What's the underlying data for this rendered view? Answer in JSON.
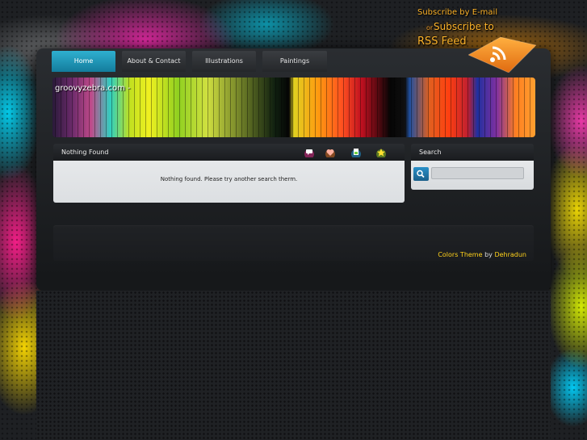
{
  "subscribe": {
    "email": "Subscribe by E-mail",
    "or": "or",
    "to": "Subscribe to",
    "rss": "RSS Feed"
  },
  "nav": {
    "tabs": [
      {
        "label": "Home",
        "active": true
      },
      {
        "label": "About & Contact",
        "active": false
      },
      {
        "label": "Illustrations",
        "active": false
      },
      {
        "label": "Paintings",
        "active": false
      }
    ]
  },
  "banner": {
    "site_title": "groovyzebra.com -"
  },
  "content": {
    "heading": "Nothing Found",
    "message": "Nothing found. Please try another search therm.",
    "header_icons": [
      "comment-icon",
      "heart-icon",
      "document-icon",
      "star-icon"
    ]
  },
  "search": {
    "heading": "Search",
    "input_value": ""
  },
  "footer": {
    "theme_name": "Colors Theme",
    "by": "by",
    "author": "Dehradun"
  },
  "colors": {
    "accent": "#1f9fc0",
    "footer_link": "#ffd11a",
    "rss_orange": "#ff9a20"
  }
}
